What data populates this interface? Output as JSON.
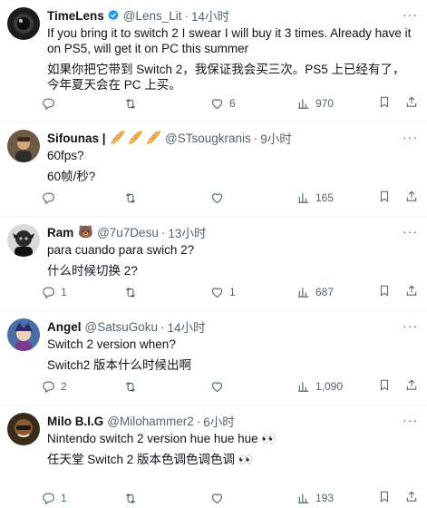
{
  "tweets": [
    {
      "name": "TimeLens",
      "handle": "@Lens_Lit",
      "time": "14小时",
      "verified": true,
      "avatar_icon": "lens-avatar",
      "text_en": "If you bring it to switch 2 I swear I will buy it 3 times. Already have it on PS5, will get it on PC this summer",
      "text_zh": "如果你把它带到 Switch 2，我保证我会买三次。PS5 上已经有了，今年夏天会在 PC 上买。",
      "replies": "",
      "retweets": "",
      "likes": "6",
      "views": "970"
    },
    {
      "name": "Sifounas |",
      "handle": "@STsougkranis",
      "time": "9小时",
      "verified": false,
      "emojis": [
        "🥖",
        "🥖",
        "🥖"
      ],
      "text_en": "60fps?",
      "text_zh": "60帧/秒?",
      "replies": "",
      "retweets": "",
      "likes": "",
      "views": "165"
    },
    {
      "name": "Ram",
      "handle": "@7u7Desu",
      "time": "13小时",
      "verified": false,
      "emojis": [
        "🐻"
      ],
      "text_en": "para cuando para swich 2?",
      "text_zh": "什么时候切换 2?",
      "replies": "1",
      "retweets": "",
      "likes": "1",
      "views": "687"
    },
    {
      "name": "Angel",
      "handle": "@SatsuGoku",
      "time": "14小时",
      "verified": false,
      "text_en": "Switch 2 version when?",
      "text_zh": "Switch2 版本什么时候出啊",
      "replies": "2",
      "retweets": "",
      "likes": "",
      "views": "1,090"
    },
    {
      "name": "Milo B.I.G",
      "handle": "@Milohammer2",
      "time": "6小时",
      "verified": false,
      "text_en": "Nintendo switch 2 version hue hue hue 👀",
      "text_zh": "任天堂 Switch 2 版本色调色调色调 👀",
      "replies": "1",
      "retweets": "",
      "likes": "",
      "views": "193"
    }
  ],
  "separator": "·",
  "more_glyph": "···",
  "colors": {
    "text": "#0f1419",
    "secondary": "#536471",
    "verified": "#1d9bf0",
    "divider": "#eff3f4"
  },
  "icons": {
    "reply": "reply-icon",
    "retweet": "retweet-icon",
    "like": "like-icon",
    "views": "views-icon",
    "bookmark": "bookmark-icon",
    "share": "share-icon",
    "more": "more-icon"
  }
}
